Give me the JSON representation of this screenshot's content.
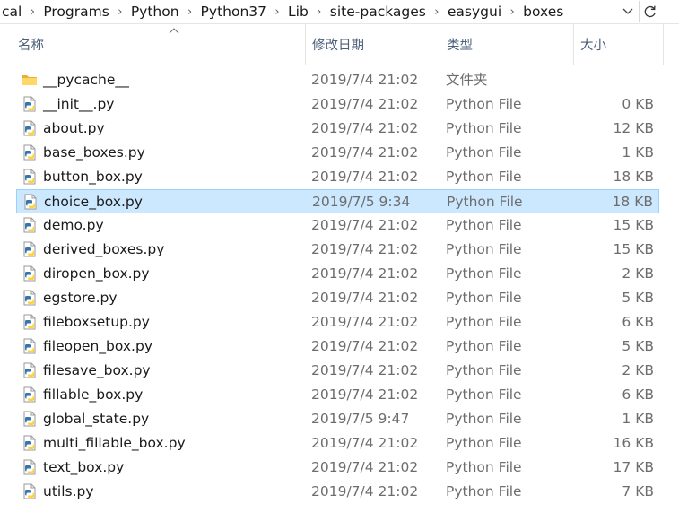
{
  "breadcrumb": [
    "cal",
    "Programs",
    "Python",
    "Python37",
    "Lib",
    "site-packages",
    "easygui",
    "boxes"
  ],
  "columns": {
    "name": "名称",
    "date": "修改日期",
    "type": "类型",
    "size": "大小"
  },
  "accent": {
    "selected_bg": "#cce8ff",
    "selected_border": "#99d1ff",
    "folder": "#f4c64e",
    "python_blue": "#3776ab",
    "python_yellow": "#ffd43b"
  },
  "files": [
    {
      "name": "__pycache__",
      "date": "2019/7/4 21:02",
      "type": "文件夹",
      "size": "",
      "icon": "folder-icon"
    },
    {
      "name": "__init__.py",
      "date": "2019/7/4 21:02",
      "type": "Python File",
      "size": "0 KB",
      "icon": "python-file-icon"
    },
    {
      "name": "about.py",
      "date": "2019/7/4 21:02",
      "type": "Python File",
      "size": "12 KB",
      "icon": "python-file-icon"
    },
    {
      "name": "base_boxes.py",
      "date": "2019/7/4 21:02",
      "type": "Python File",
      "size": "1 KB",
      "icon": "python-file-icon"
    },
    {
      "name": "button_box.py",
      "date": "2019/7/4 21:02",
      "type": "Python File",
      "size": "18 KB",
      "icon": "python-file-icon"
    },
    {
      "name": "choice_box.py",
      "date": "2019/7/5 9:34",
      "type": "Python File",
      "size": "18 KB",
      "icon": "python-file-icon",
      "selected": true
    },
    {
      "name": "demo.py",
      "date": "2019/7/4 21:02",
      "type": "Python File",
      "size": "15 KB",
      "icon": "python-file-icon"
    },
    {
      "name": "derived_boxes.py",
      "date": "2019/7/4 21:02",
      "type": "Python File",
      "size": "15 KB",
      "icon": "python-file-icon"
    },
    {
      "name": "diropen_box.py",
      "date": "2019/7/4 21:02",
      "type": "Python File",
      "size": "2 KB",
      "icon": "python-file-icon"
    },
    {
      "name": "egstore.py",
      "date": "2019/7/4 21:02",
      "type": "Python File",
      "size": "5 KB",
      "icon": "python-file-icon"
    },
    {
      "name": "fileboxsetup.py",
      "date": "2019/7/4 21:02",
      "type": "Python File",
      "size": "6 KB",
      "icon": "python-file-icon"
    },
    {
      "name": "fileopen_box.py",
      "date": "2019/7/4 21:02",
      "type": "Python File",
      "size": "5 KB",
      "icon": "python-file-icon"
    },
    {
      "name": "filesave_box.py",
      "date": "2019/7/4 21:02",
      "type": "Python File",
      "size": "2 KB",
      "icon": "python-file-icon"
    },
    {
      "name": "fillable_box.py",
      "date": "2019/7/4 21:02",
      "type": "Python File",
      "size": "6 KB",
      "icon": "python-file-icon"
    },
    {
      "name": "global_state.py",
      "date": "2019/7/5 9:47",
      "type": "Python File",
      "size": "1 KB",
      "icon": "python-file-icon"
    },
    {
      "name": "multi_fillable_box.py",
      "date": "2019/7/4 21:02",
      "type": "Python File",
      "size": "16 KB",
      "icon": "python-file-icon"
    },
    {
      "name": "text_box.py",
      "date": "2019/7/4 21:02",
      "type": "Python File",
      "size": "17 KB",
      "icon": "python-file-icon"
    },
    {
      "name": "utils.py",
      "date": "2019/7/4 21:02",
      "type": "Python File",
      "size": "7 KB",
      "icon": "python-file-icon"
    }
  ]
}
